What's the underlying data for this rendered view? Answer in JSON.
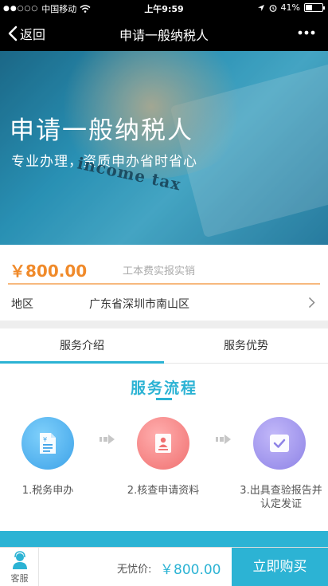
{
  "status_bar": {
    "carrier": "中国移动",
    "time": "上午9:59",
    "battery": "41%",
    "battery_level": 0.41
  },
  "nav": {
    "back_label": "返回",
    "title": "申请一般纳税人"
  },
  "hero": {
    "title": "申请一般纳税人",
    "subtitle": "专业办理，资质申办省时省心",
    "stamp_text": "income tax"
  },
  "price": {
    "amount": "￥800.00",
    "note": "工本费实报实销"
  },
  "region": {
    "label": "地区",
    "value": "广东省深圳市南山区"
  },
  "tabs": [
    {
      "label": "服务介绍",
      "active": true
    },
    {
      "label": "服务优势",
      "active": false
    }
  ],
  "process": {
    "title": "服务流程",
    "steps": [
      {
        "label": "1.税务申办",
        "icon": "document-icon"
      },
      {
        "label": "2.核查申请资料",
        "icon": "profile-card-icon"
      },
      {
        "label": "3.出具查验报告并认定发证",
        "icon": "checkbox-icon"
      }
    ]
  },
  "bottom_bar": {
    "cs_label": "客服",
    "price_label": "无忧价:",
    "price_value": "￥800.00",
    "buy_label": "立即购买"
  },
  "colors": {
    "accent": "#2cb3d4",
    "price": "#f08a2a"
  }
}
